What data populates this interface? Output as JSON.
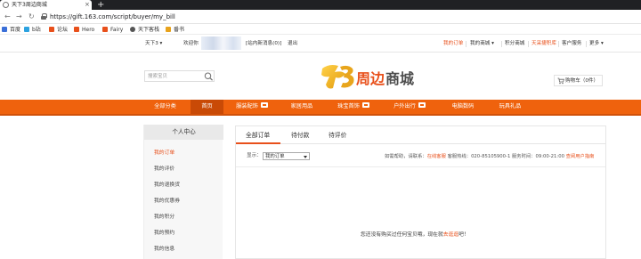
{
  "browser": {
    "tab_title": "天下3周边商城",
    "url": "https://gift.163.com/script/buyer/my_bill",
    "bookmarks": [
      "百度",
      "b站",
      "论坛",
      "Hero",
      "Fairy",
      "天下客栈",
      "番书"
    ]
  },
  "topbar": {
    "game": "天下3",
    "welcome": "欢迎你",
    "messages": "[站内新消息(0)]",
    "logout": "退出",
    "my_orders": "我的订单",
    "my_mall": "我的商城",
    "points_mall": "积分商城",
    "dianzhuan": "天采捷积库",
    "service": "客户服务",
    "more": "更多"
  },
  "header": {
    "search_placeholder": "搜索宝贝",
    "logo_text": "天下3 周边商城",
    "cart_label": "购物车（0件）"
  },
  "nav": {
    "items": [
      "全部分类",
      "首页",
      "服装配饰",
      "家居用品",
      "珠宝首饰",
      "户外出行",
      "电脑数码",
      "玩具礼品"
    ]
  },
  "sidebar": {
    "title": "个人中心",
    "items": [
      "我的订单",
      "我的评价",
      "我的退换货",
      "我的优惠券",
      "我的积分",
      "我的预约",
      "我的信息"
    ]
  },
  "orders": {
    "tabs": [
      "全部订单",
      "待付款",
      "待评价"
    ],
    "filter_label": "显示：",
    "filter_value": "我的订单",
    "help_prefix": "如需帮助，请联系：",
    "help_online": "在线客服",
    "help_hotline": "客服热线：020-85105900-1 服务时间：09:00-21:00",
    "help_guide": "查阅用户指南",
    "empty_text": "您还没有购买过任何宝贝哦，现在就",
    "empty_link": "去逛逛",
    "empty_suffix": "吧！"
  },
  "colors": {
    "accent": "#ef620d",
    "accent_text": "#e8501b"
  },
  "icons": [
    "search-icon",
    "cart-icon",
    "lock-icon",
    "back-icon",
    "forward-icon",
    "reload-icon"
  ]
}
